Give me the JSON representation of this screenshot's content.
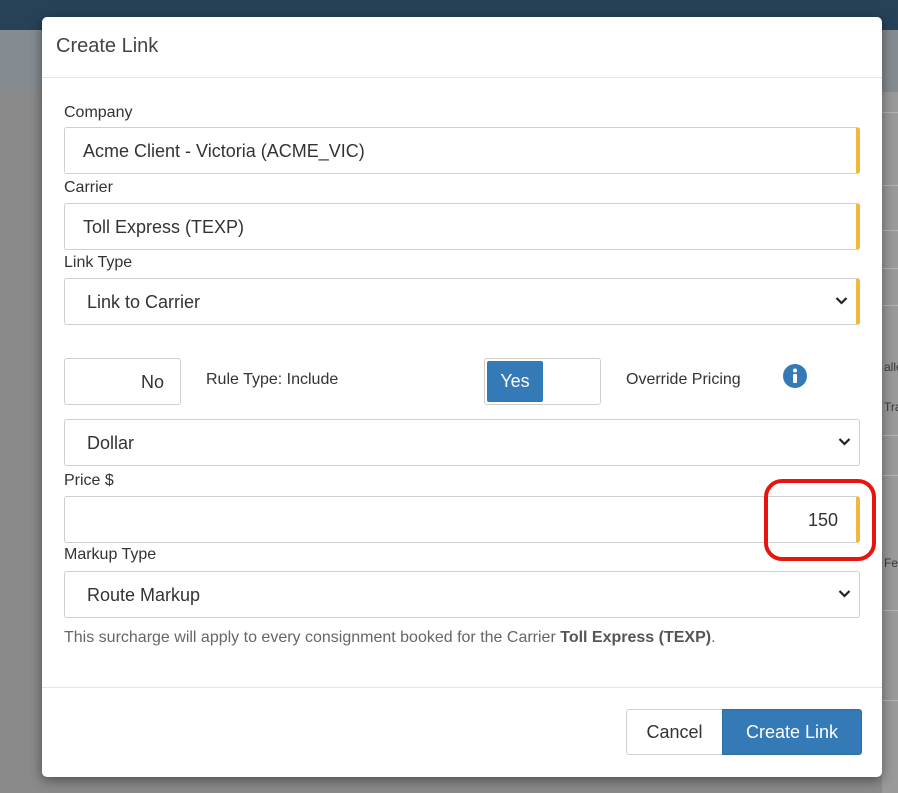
{
  "modal": {
    "title": "Create Link",
    "company": {
      "label": "Company",
      "value": "Acme Client - Victoria (ACME_VIC)"
    },
    "carrier": {
      "label": "Carrier",
      "value": "Toll Express (TEXP)"
    },
    "link_type": {
      "label": "Link Type",
      "value": "Link to Carrier"
    },
    "rule_toggle": {
      "off_label": "No",
      "label": "Rule Type: Include"
    },
    "override_toggle": {
      "on_label": "Yes",
      "label": "Override Pricing"
    },
    "pricing_unit": {
      "value": "Dollar"
    },
    "price": {
      "label": "Price $",
      "value": "150"
    },
    "markup_type": {
      "label": "Markup Type",
      "value": "Route Markup"
    },
    "help_text": {
      "prefix": "This surcharge will apply to every consignment booked for the Carrier ",
      "carrier": "Toll Express (TEXP)",
      "suffix": "."
    },
    "buttons": {
      "cancel": "Cancel",
      "create": "Create Link"
    }
  },
  "background": {
    "fragments": [
      "alle",
      "Tra",
      "Fe"
    ]
  },
  "colors": {
    "primary": "#337ab7",
    "required_marker": "#f0b93a",
    "highlight": "#e8150e",
    "topbar": "#274257"
  },
  "icons": {
    "info": "info-circle-icon",
    "chevron": "chevron-down-icon"
  }
}
